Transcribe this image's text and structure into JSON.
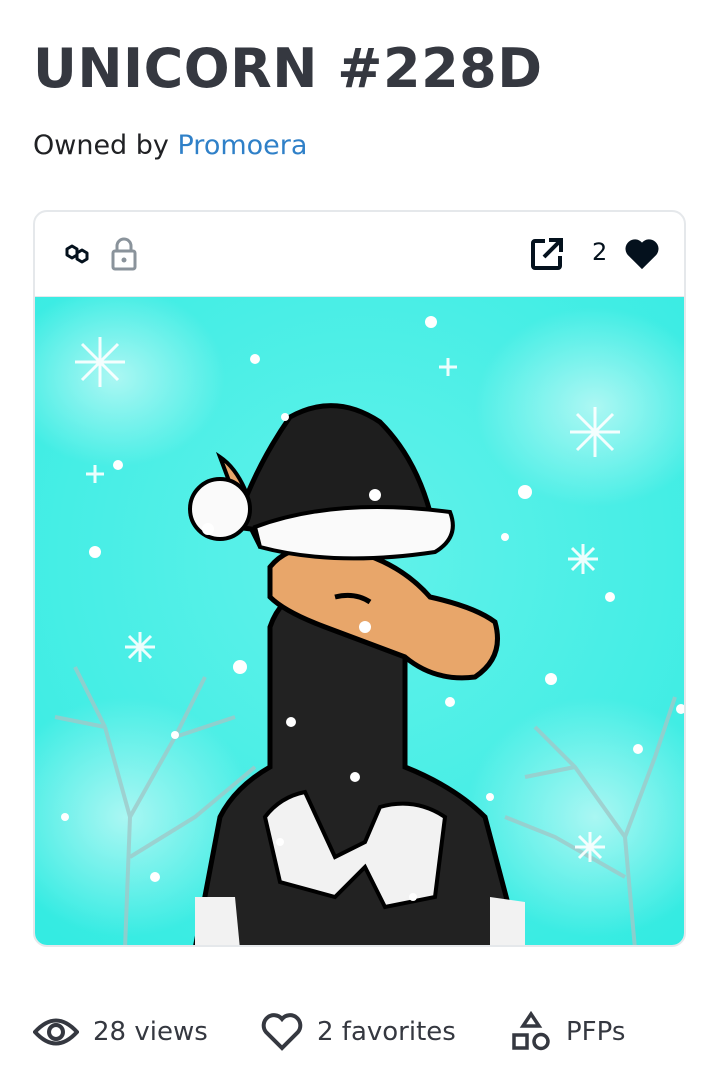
{
  "asset": {
    "title": "UNICORN #228D",
    "owned_by_label": "Owned by",
    "owner_name": "Promoera"
  },
  "card": {
    "chain_icon": "polygon-chain-icon",
    "lock_icon": "lock-icon",
    "external_icon": "external-link-icon",
    "favorite_icon": "heart-filled-icon",
    "favorite_count": "2"
  },
  "stats": {
    "views": "28 views",
    "favorites": "2 favorites",
    "category": "PFPs"
  },
  "colors": {
    "background_art": "#3ef0e6",
    "link": "#2f80c8",
    "text": "#353840"
  }
}
